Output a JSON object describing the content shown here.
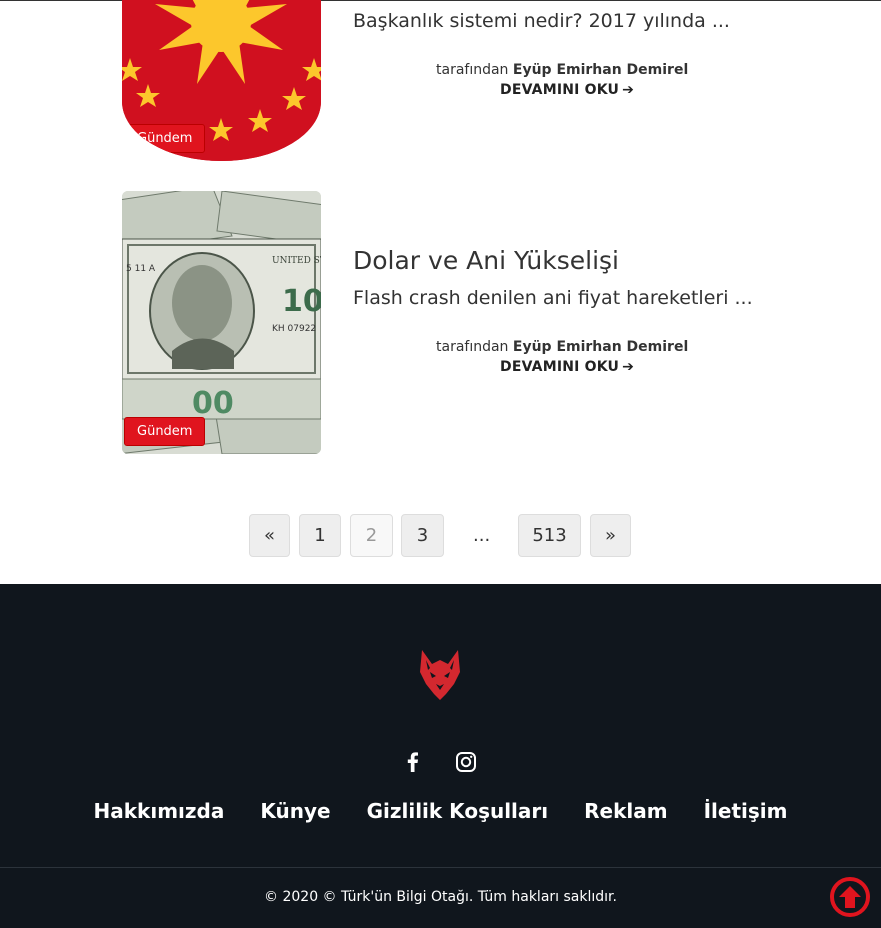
{
  "posts": [
    {
      "category": "Gündem",
      "excerpt": "Başkanlık sistemi nedir? 2017 yılında ...",
      "byline_prefix": "tarafından",
      "author": "Eyüp Emirhan Demirel",
      "read_more": "DEVAMINI OKU"
    },
    {
      "category": "Gündem",
      "title": "Dolar ve Ani Yükselişi",
      "excerpt": "Flash crash denilen ani fiyat hareketleri ...",
      "byline_prefix": "tarafından",
      "author": "Eyüp Emirhan Demirel",
      "read_more": "DEVAMINI OKU"
    }
  ],
  "pagination": {
    "prev": "«",
    "pages": [
      "1",
      "2",
      "3"
    ],
    "current": "2",
    "ellipsis": "...",
    "last": "513",
    "next": "»"
  },
  "footer": {
    "social_icons": [
      "facebook-icon",
      "instagram-icon"
    ],
    "nav": [
      "Hakkımızda",
      "Künye",
      "Gizlilik Koşulları",
      "Reklam",
      "İletişim"
    ],
    "copyright": "© 2020 © Türk'ün Bilgi Otağı. Tüm hakları saklıdır."
  },
  "colors": {
    "accent_red": "#e0141e",
    "footer_bg": "#10161d"
  }
}
